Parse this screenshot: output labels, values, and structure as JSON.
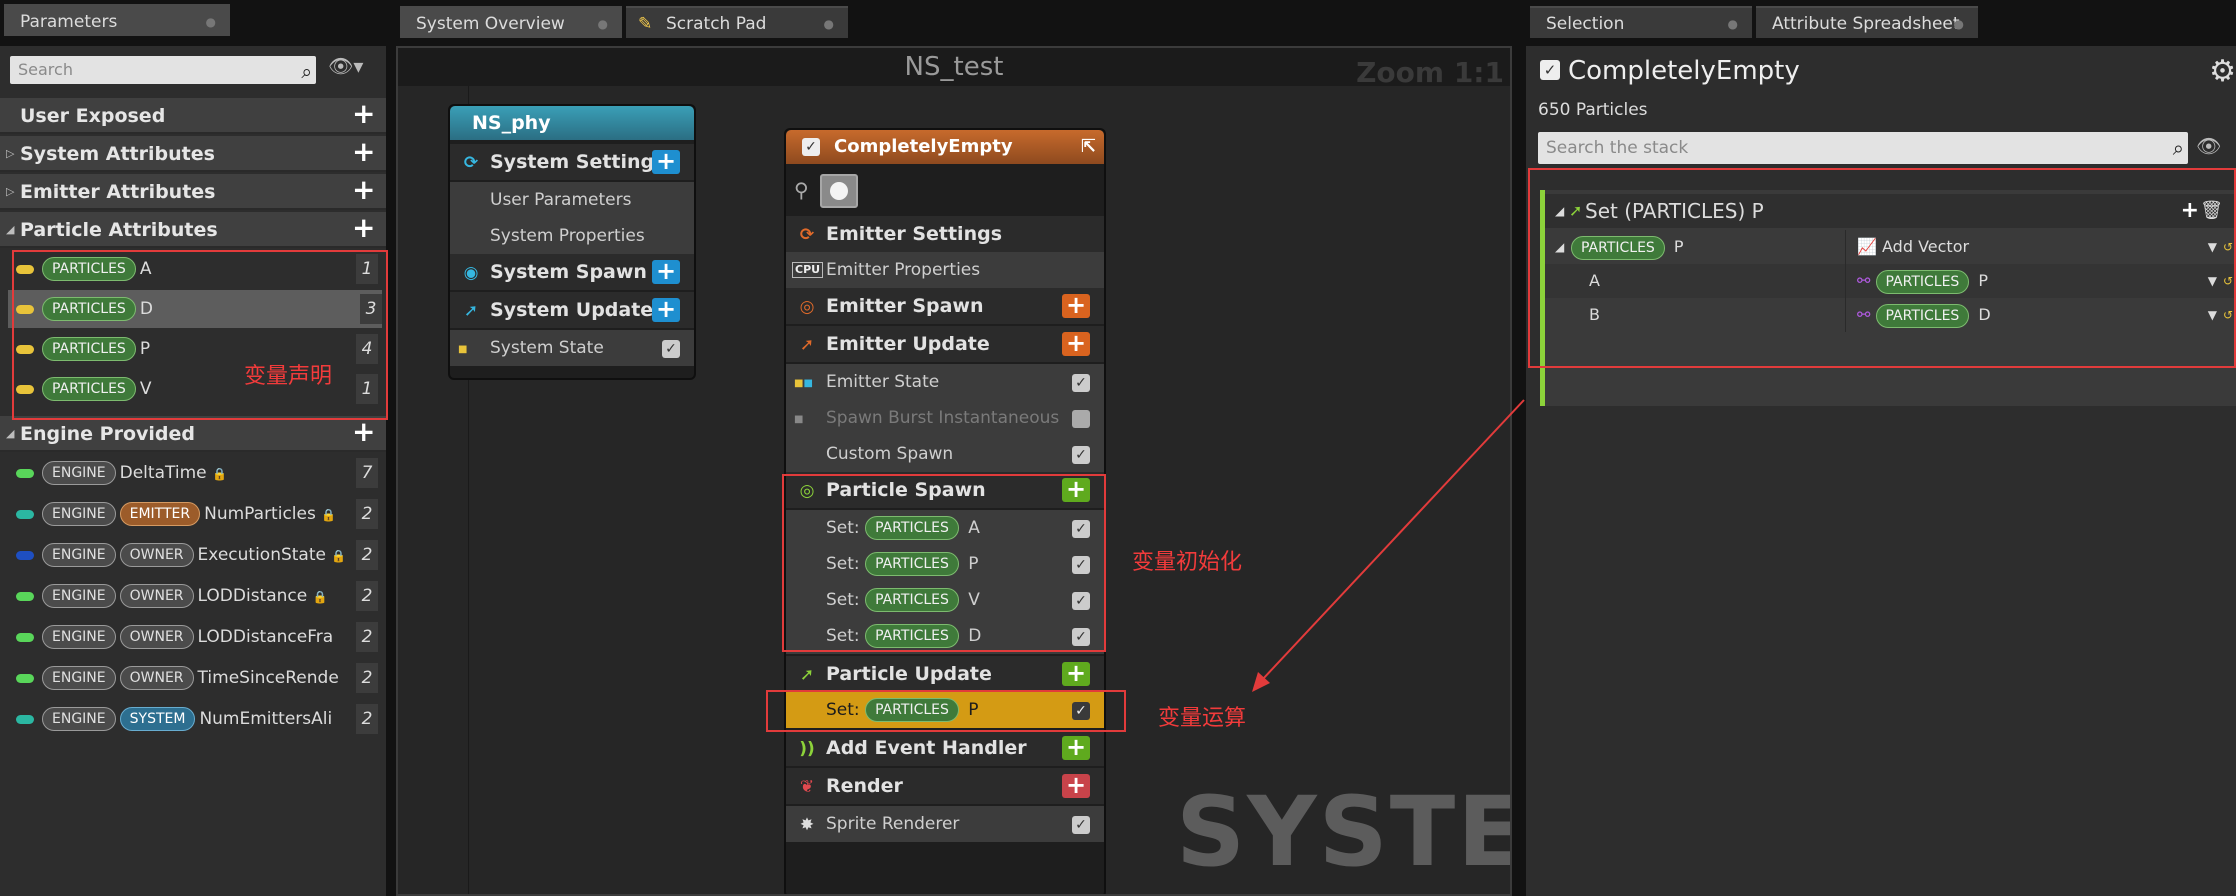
{
  "tabs": {
    "parameters": "Parameters",
    "system_overview": "System Overview",
    "scratch_pad": "Scratch Pad",
    "selection": "Selection",
    "attribute_spreadsheet": "Attribute Spreadsheet"
  },
  "params": {
    "search_placeholder": "Search",
    "categories": {
      "user_exposed": "User Exposed",
      "system": "System Attributes",
      "emitter": "Emitter Attributes",
      "particle": "Particle Attributes",
      "engine": "Engine Provided"
    },
    "particle_rows": [
      {
        "ns": "PARTICLES",
        "name": "A",
        "count": "1",
        "color": "#e8c33a"
      },
      {
        "ns": "PARTICLES",
        "name": "D",
        "count": "3",
        "color": "#e8c33a"
      },
      {
        "ns": "PARTICLES",
        "name": "P",
        "count": "4",
        "color": "#e8c33a"
      },
      {
        "ns": "PARTICLES",
        "name": "V",
        "count": "1",
        "color": "#e8c33a"
      }
    ],
    "engine_rows": [
      {
        "ns": "ENGINE",
        "ns2": "",
        "name": "DeltaTime",
        "lock": "🔒",
        "count": "7",
        "color": "#59d65a"
      },
      {
        "ns": "ENGINE",
        "ns2": "EMITTER",
        "name": "NumParticles",
        "lock": "🔒",
        "count": "2",
        "color": "#2bb7a2"
      },
      {
        "ns": "ENGINE",
        "ns2": "OWNER",
        "name": "ExecutionState",
        "lock": "🔒",
        "count": "2",
        "color": "#1e4fc2"
      },
      {
        "ns": "ENGINE",
        "ns2": "OWNER",
        "name": "LODDistance",
        "lock": "🔒",
        "count": "2",
        "color": "#59d65a"
      },
      {
        "ns": "ENGINE",
        "ns2": "OWNER",
        "name": "LODDistanceFra",
        "lock": "",
        "count": "2",
        "color": "#59d65a"
      },
      {
        "ns": "ENGINE",
        "ns2": "OWNER",
        "name": "TimeSinceRende",
        "lock": "",
        "count": "2",
        "color": "#59d65a"
      },
      {
        "ns": "ENGINE",
        "ns2": "SYSTEM",
        "name": "NumEmittersAli",
        "lock": "",
        "count": "2",
        "color": "#2bb7a2"
      }
    ],
    "annotation": "变量声明"
  },
  "graph": {
    "title": "NS_test",
    "zoom": "Zoom 1:1",
    "watermark": "SYSTEM",
    "system_node": {
      "title": "NS_phy",
      "items": [
        "System Settings",
        "User Parameters",
        "System Properties",
        "System Spawn",
        "System Update",
        "System State"
      ]
    },
    "emitter_node": {
      "title": "CompletelyEmpty",
      "items": {
        "emitter_settings": "Emitter Settings",
        "emitter_properties": "Emitter Properties",
        "emitter_spawn": "Emitter Spawn",
        "emitter_update": "Emitter Update",
        "emitter_state": "Emitter State",
        "spawn_burst": "Spawn Burst Instantaneous",
        "custom_spawn": "Custom Spawn",
        "particle_spawn": "Particle Spawn",
        "particle_update": "Particle Update",
        "add_event": "Add Event Handler",
        "render": "Render",
        "sprite_renderer": "Sprite Renderer",
        "cpu": "CPU"
      },
      "spawn_sets": [
        {
          "label": "Set:",
          "ns": "PARTICLES",
          "var": "A"
        },
        {
          "label": "Set:",
          "ns": "PARTICLES",
          "var": "P"
        },
        {
          "label": "Set:",
          "ns": "PARTICLES",
          "var": "V"
        },
        {
          "label": "Set:",
          "ns": "PARTICLES",
          "var": "D"
        }
      ],
      "update_set": {
        "label": "Set:",
        "ns": "PARTICLES",
        "var": "P"
      }
    },
    "annotation_init": "变量初始化",
    "annotation_calc": "变量运算"
  },
  "selection": {
    "name": "CompletelyEmpty",
    "particles": "650 Particles",
    "search_placeholder": "Search the stack",
    "module_title": "Set (PARTICLES) P",
    "rows": [
      {
        "ns": "PARTICLES",
        "name": "P",
        "value": "Add Vector",
        "value_ns": ""
      },
      {
        "ns": "",
        "name": "A",
        "value": "P",
        "value_ns": "PARTICLES"
      },
      {
        "ns": "",
        "name": "B",
        "value": "D",
        "value_ns": "PARTICLES"
      }
    ]
  }
}
